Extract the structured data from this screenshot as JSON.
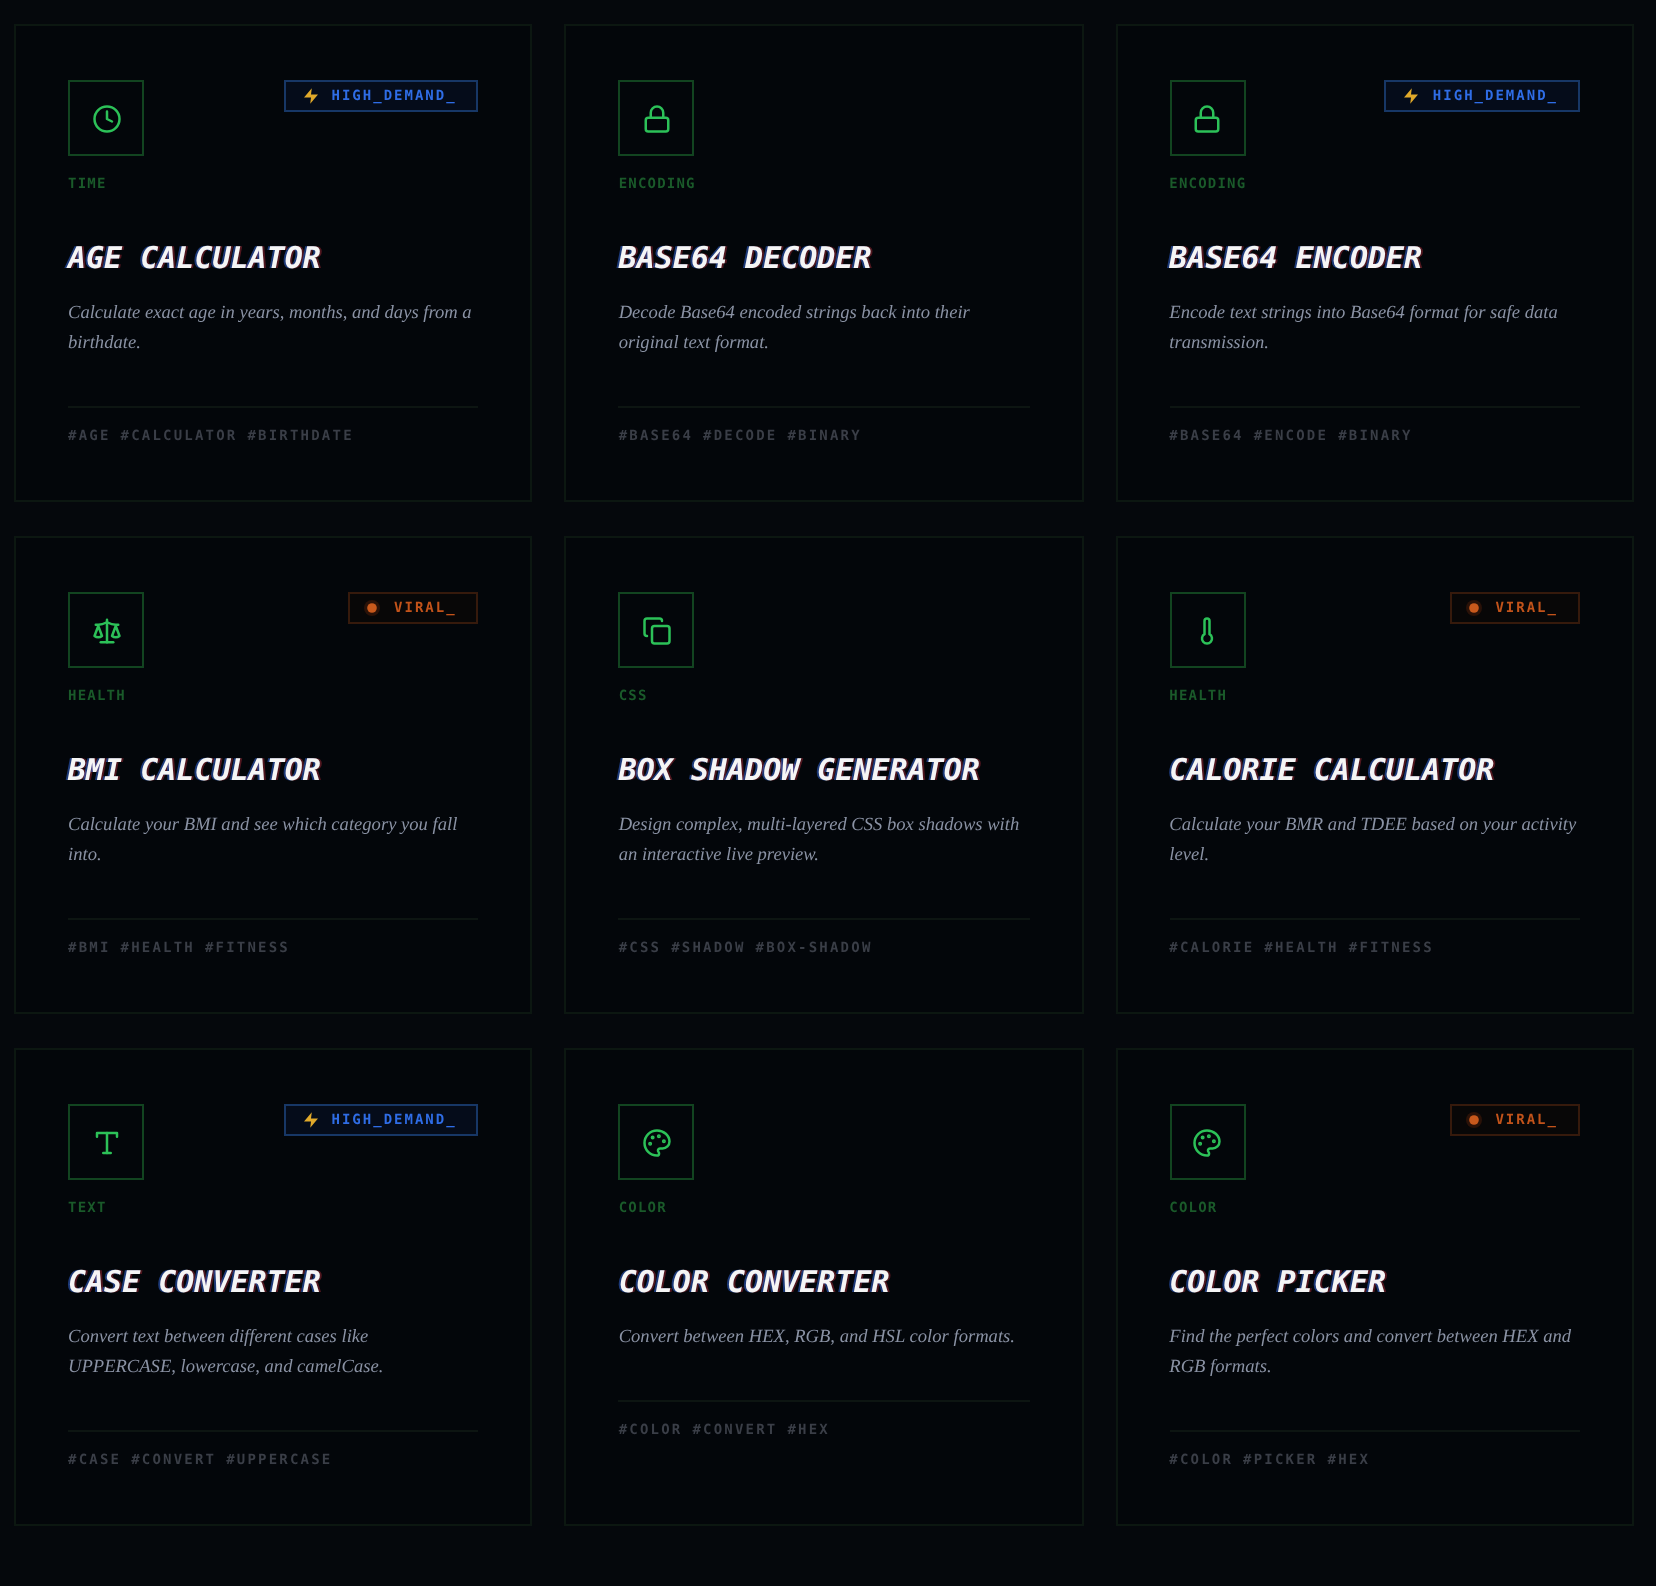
{
  "cards": [
    {
      "category": "TIME",
      "title": "AGE CALCULATOR",
      "description": "Calculate exact age in years, months, and days from a birthdate.",
      "tags": [
        "#AGE",
        "#CALCULATOR",
        "#BIRTHDATE"
      ],
      "badge": {
        "kind": "high_demand",
        "label": "HIGH_DEMAND_"
      }
    },
    {
      "category": "ENCODING",
      "title": "BASE64 DECODER",
      "description": "Decode Base64 encoded strings back into their original text format.",
      "tags": [
        "#BASE64",
        "#DECODE",
        "#BINARY"
      ]
    },
    {
      "category": "ENCODING",
      "title": "BASE64 ENCODER",
      "description": "Encode text strings into Base64 format for safe data transmission.",
      "tags": [
        "#BASE64",
        "#ENCODE",
        "#BINARY"
      ],
      "badge": {
        "kind": "high_demand",
        "label": "HIGH_DEMAND_"
      }
    },
    {
      "category": "HEALTH",
      "title": "BMI CALCULATOR",
      "description": "Calculate your BMI and see which category you fall into.",
      "tags": [
        "#BMI",
        "#HEALTH",
        "#FITNESS"
      ],
      "badge": {
        "kind": "viral",
        "label": "VIRAL_"
      }
    },
    {
      "category": "CSS",
      "title": "BOX SHADOW GENERATOR",
      "description": "Design complex, multi-layered CSS box shadows with an interactive live preview.",
      "tags": [
        "#CSS",
        "#SHADOW",
        "#BOX-SHADOW"
      ]
    },
    {
      "category": "HEALTH",
      "title": "CALORIE CALCULATOR",
      "description": "Calculate your BMR and TDEE based on your activity level.",
      "tags": [
        "#CALORIE",
        "#HEALTH",
        "#FITNESS"
      ],
      "badge": {
        "kind": "viral",
        "label": "VIRAL_"
      }
    },
    {
      "category": "TEXT",
      "title": "CASE CONVERTER",
      "description": "Convert text between different cases like UPPERCASE, lowercase, and camelCase.",
      "tags": [
        "#CASE",
        "#CONVERT",
        "#UPPERCASE"
      ],
      "badge": {
        "kind": "high_demand",
        "label": "HIGH_DEMAND_"
      }
    },
    {
      "category": "COLOR",
      "title": "COLOR CONVERTER",
      "description": "Convert between HEX, RGB, and HSL color formats.",
      "tags": [
        "#COLOR",
        "#CONVERT",
        "#HEX"
      ]
    },
    {
      "category": "COLOR",
      "title": "COLOR PICKER",
      "description": "Find the perfect colors and convert between HEX and RGB formats.",
      "tags": [
        "#COLOR",
        "#PICKER",
        "#HEX"
      ],
      "badge": {
        "kind": "viral",
        "label": "VIRAL_"
      }
    }
  ]
}
